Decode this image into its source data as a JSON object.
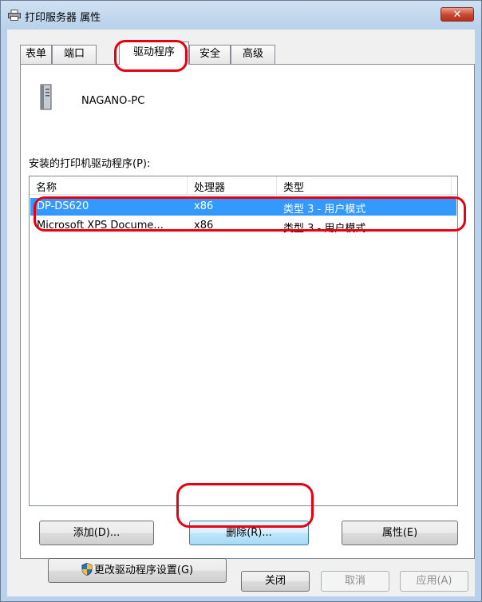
{
  "window": {
    "title": "打印服务器 属性",
    "close_label": "✕"
  },
  "tabs": [
    {
      "label": "表单"
    },
    {
      "label": "端口"
    },
    {
      "label": "驱动程序"
    },
    {
      "label": "安全"
    },
    {
      "label": "高级"
    }
  ],
  "active_tab": "驱动程序",
  "server": {
    "name": "NAGANO-PC"
  },
  "drivers": {
    "label": "安装的打印机驱动程序(P):",
    "columns": [
      "名称",
      "处理器",
      "类型"
    ],
    "rows": [
      {
        "name": "DP-DS620",
        "processor": "x86",
        "type": "类型 3 - 用户模式",
        "selected": true
      },
      {
        "name": "Microsoft XPS Docume...",
        "processor": "x86",
        "type": "类型 3 - 用户模式",
        "selected": false
      }
    ]
  },
  "buttons": {
    "add": "添加(D)...",
    "remove": "删除(R)...",
    "properties": "属性(E)",
    "change_settings": "更改驱动程序设置(G)",
    "close": "关闭",
    "cancel": "取消",
    "apply": "应用(A)"
  },
  "colors": {
    "selection": "#3399ff",
    "annotation": "#e60012",
    "window_frame": "#b9d1ea"
  }
}
